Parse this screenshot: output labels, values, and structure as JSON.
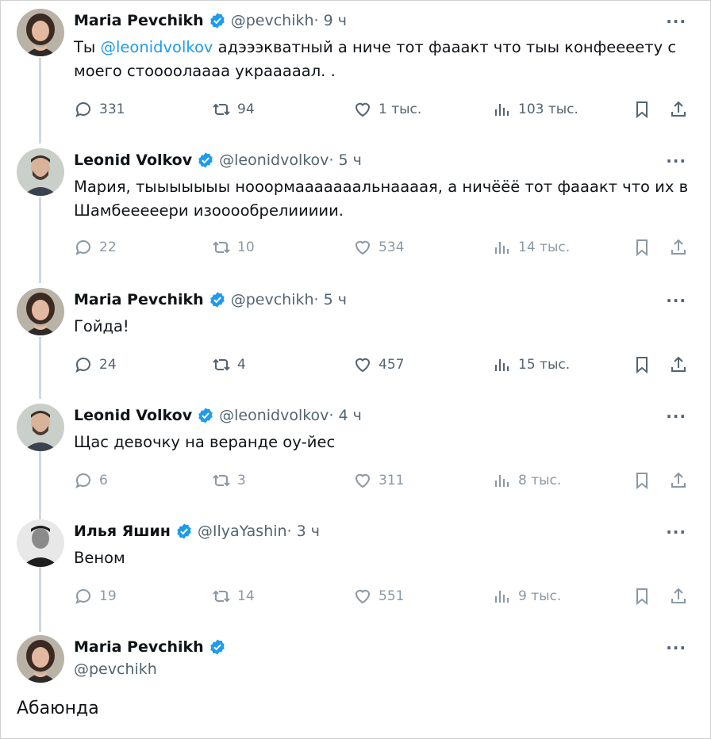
{
  "colors": {
    "accent": "#1d9bf0",
    "muted": "#536471",
    "thread": "#cfd9de"
  },
  "tweets": [
    {
      "name": "Maria Pevchikh",
      "handle": "@pevchikh",
      "time": " · 9 ч",
      "text_pre": "Ты ",
      "mention": "@leonidvolkov",
      "text_post": "  адэээкватный а ниче тот фааакт что тыы конфеееету с моего стоооолаааа украаааал. .",
      "replies": "331",
      "retweets": "94",
      "likes": "1 тыс.",
      "views": "103 тыс."
    },
    {
      "name": "Leonid Volkov",
      "handle": "@leonidvolkov",
      "time": " · 5 ч",
      "text": "Мария, тыыыыыыы нооормааааааальнаааая, а ничёёё тот фааакт что их в Шамбееееери изооообрелиииии.",
      "replies": "22",
      "retweets": "10",
      "likes": "534",
      "views": "14 тыс."
    },
    {
      "name": "Maria Pevchikh",
      "handle": "@pevchikh",
      "time": " · 5 ч",
      "text": "Гойда!",
      "replies": "24",
      "retweets": "4",
      "likes": "457",
      "views": "15 тыс."
    },
    {
      "name": "Leonid Volkov",
      "handle": "@leonidvolkov",
      "time": " · 4 ч",
      "text": "Щас девочку на веранде оу-йес",
      "replies": "6",
      "retweets": "3",
      "likes": "311",
      "views": "8 тыс."
    },
    {
      "name": "Илья Яшин",
      "handle": "@IlyaYashin",
      "time": " · 3 ч",
      "text": "Веном",
      "replies": "19",
      "retweets": "14",
      "likes": "551",
      "views": "9 тыс."
    }
  ],
  "main_tweet": {
    "name": "Maria Pevchikh",
    "handle": "@pevchikh",
    "text": "Абаюнда"
  },
  "icons": [
    "verified-icon",
    "reply-icon",
    "retweet-icon",
    "like-icon",
    "views-icon",
    "bookmark-icon",
    "share-icon",
    "more-icon"
  ]
}
